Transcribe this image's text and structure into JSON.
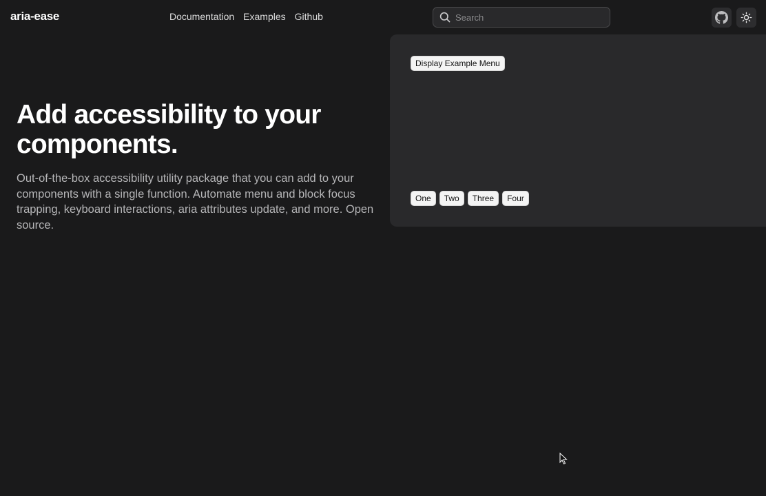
{
  "header": {
    "logo": "aria-ease",
    "nav": [
      {
        "label": "Documentation"
      },
      {
        "label": "Examples"
      },
      {
        "label": "Github"
      }
    ],
    "search": {
      "placeholder": "Search",
      "icon": "search-icon"
    },
    "actions": [
      {
        "icon": "github-icon"
      },
      {
        "icon": "sun-icon"
      }
    ]
  },
  "hero": {
    "title": "Add accessibility to your components.",
    "description": "Out-of-the-box accessibility utility package that you can add to your components with a single function. Automate menu and block focus trapping, keyboard interactions, aria attributes update, and more. Open source."
  },
  "demo": {
    "menu_button_label": "Display Example Menu",
    "buttons": [
      {
        "label": "One"
      },
      {
        "label": "Two"
      },
      {
        "label": "Three"
      },
      {
        "label": "Four"
      }
    ]
  },
  "colors": {
    "background": "#1a1a1b",
    "panel": "#29292b",
    "button_bg": "#f4f4f4"
  }
}
